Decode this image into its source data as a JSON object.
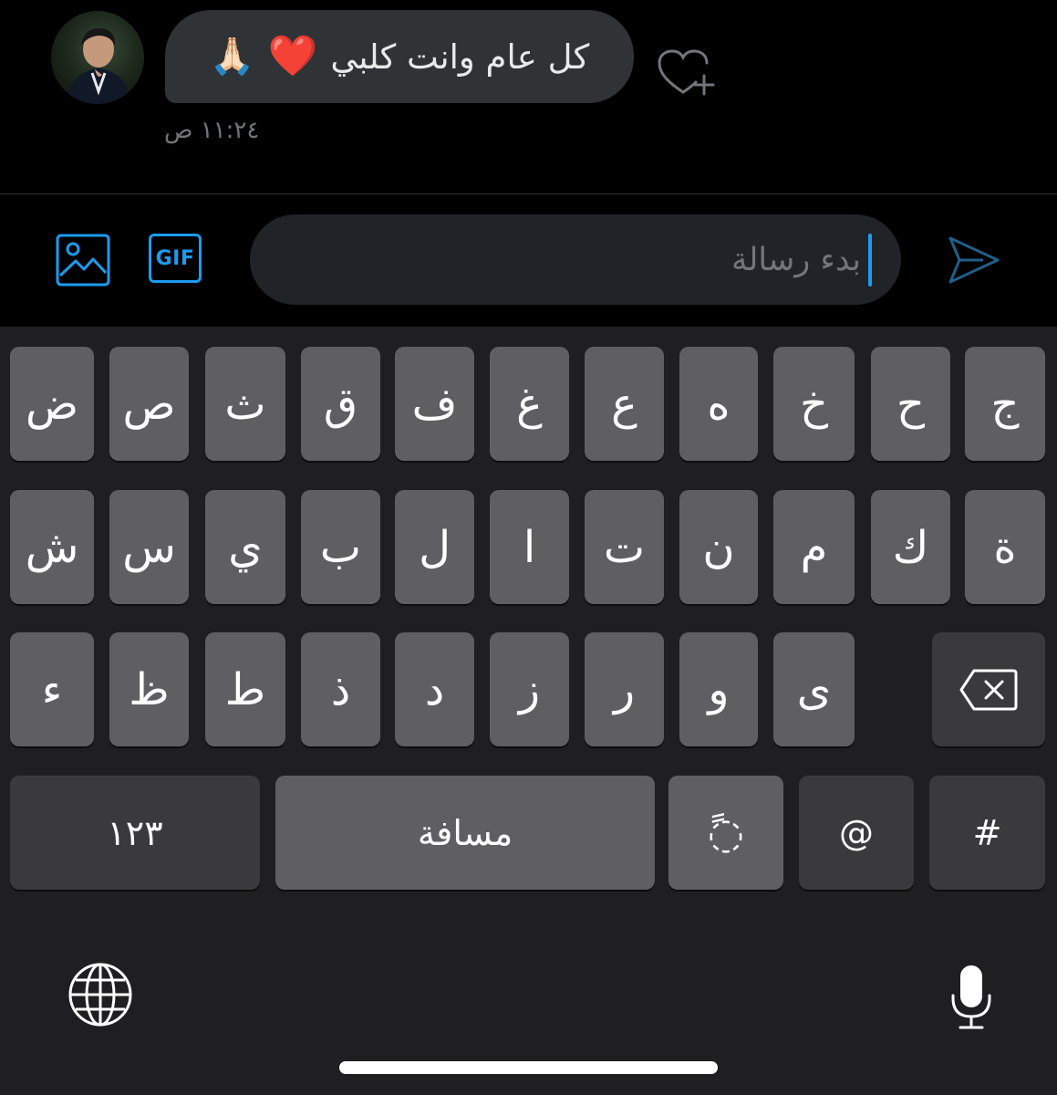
{
  "conversation": {
    "message": {
      "text": "كل عام وانت كلبي",
      "emoji_1": "❤️",
      "emoji_2": "🙏🏻",
      "time": "١١:٢٤ ص"
    },
    "avatar_icon": "user-avatar-photo",
    "react_icon": "heart-plus-icon"
  },
  "composer": {
    "media_icon": "image-icon",
    "gif_label": "GIF",
    "placeholder": "بدء رسالة",
    "send_icon": "send-icon",
    "accent_color": "#1d9bf0"
  },
  "keyboard": {
    "row1": [
      "ج",
      "ح",
      "خ",
      "ه",
      "ع",
      "غ",
      "ف",
      "ق",
      "ث",
      "ص",
      "ض"
    ],
    "row2": [
      "ة",
      "ك",
      "م",
      "ن",
      "ت",
      "ا",
      "ل",
      "ب",
      "ي",
      "س",
      "ش"
    ],
    "row3": [
      "ى",
      "و",
      "ر",
      "ز",
      "د",
      "ذ",
      "ط",
      "ظ",
      "ء"
    ],
    "delete_icon": "backspace-icon",
    "row4": {
      "numbers": "١٢٣",
      "space": "مسافة",
      "tanween": "ً◌",
      "at": "@",
      "hash": "#"
    },
    "globe_icon": "globe-icon",
    "mic_icon": "microphone-icon"
  }
}
